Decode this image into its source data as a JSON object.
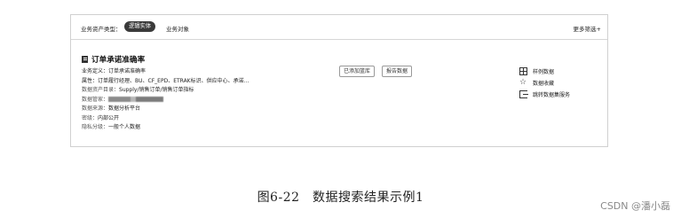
{
  "filter_bar": {
    "label": "业务资产类型：",
    "active_chip": "逻辑实体",
    "chip": "业务对象",
    "more_filter": "更多筛选+"
  },
  "result": {
    "title": "订单承诺准确率",
    "fields": [
      {
        "key": "业务定义：",
        "value": "订单承诺准确率"
      },
      {
        "key": "属性：",
        "value": "订单履行经理、BU、CF_EPD、ETRAK标识、供应中心、承诺..."
      },
      {
        "key": "数据资产目录：",
        "value": "Supply/销售订单/销售订单指标"
      },
      {
        "key": "数据管家：",
        "value": ""
      },
      {
        "key": "数据来源：",
        "value": "数据分析平台"
      },
      {
        "key": "密级：",
        "value": "内部公开"
      },
      {
        "key": "隐私分级：",
        "value": "一般个人数据"
      }
    ],
    "tags": [
      "已添加篮库",
      "报告数据"
    ],
    "actions": [
      {
        "label": "样例数据",
        "icon": "table-icon"
      },
      {
        "label": "数据收藏",
        "icon": "star-icon"
      },
      {
        "label": "跳转数据集服务",
        "icon": "export-icon"
      }
    ]
  },
  "caption": "图6-22　数据搜索结果示例1",
  "watermark": "CSDN @潘小磊"
}
